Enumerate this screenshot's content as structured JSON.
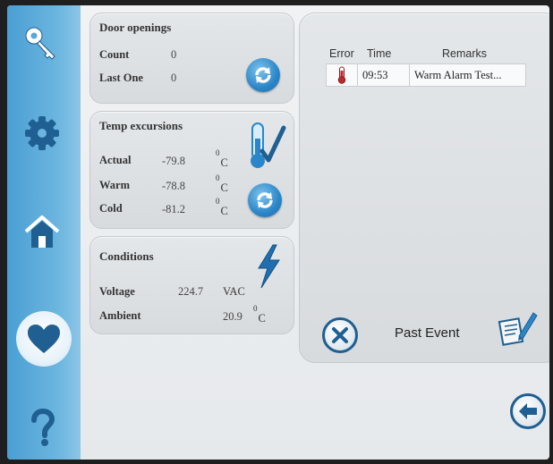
{
  "door_openings": {
    "title": "Door openings",
    "count_label": "Count",
    "count_value": "0",
    "last_label": "Last One",
    "last_value": "0"
  },
  "temp_excursions": {
    "title": "Temp excursions",
    "actual_label": "Actual",
    "actual_value": "-79.8",
    "warm_label": "Warm",
    "warm_value": "-78.8",
    "cold_label": "Cold",
    "cold_value": "-81.2",
    "unit_sup": "0",
    "unit": "C"
  },
  "conditions": {
    "title": "Conditions",
    "voltage_label": "Voltage",
    "voltage_value": "224.7",
    "voltage_unit": "VAC",
    "ambient_label": "Ambient",
    "ambient_value": "20.9",
    "unit_sup": "0",
    "unit": "C"
  },
  "events": {
    "headers": [
      "Error",
      "Time",
      "Remarks"
    ],
    "rows": [
      {
        "time": "09:53",
        "remarks": "Warm Alarm Test..."
      }
    ],
    "past_event_label": "Past Event"
  },
  "colors": {
    "sidebar": "#4a9fd3",
    "accent_blue": "#2a86c8",
    "alarm_red": "#c0282d"
  },
  "icons": {
    "sidebar": [
      "key-icon",
      "gear-icon",
      "home-icon",
      "heart-icon",
      "help-icon"
    ],
    "actions": [
      "refresh-icon",
      "thermometer-check-icon",
      "lightning-icon",
      "close-icon",
      "note-edit-icon",
      "back-arrow-icon"
    ]
  }
}
